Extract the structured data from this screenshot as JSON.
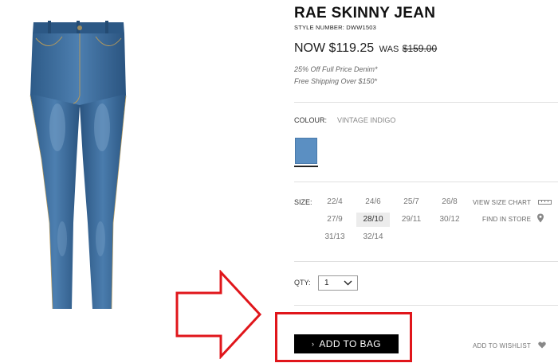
{
  "product": {
    "title": "RAE SKINNY JEAN",
    "style_number": "STYLE NUMBER: DWW1503",
    "price": {
      "now_label": "NOW $119.25",
      "was_label": "WAS",
      "original": "$159.00"
    },
    "promos": [
      "25% Off Full Price Denim*",
      "Free Shipping Over $150*"
    ],
    "image_icon": "jeans-product-photo"
  },
  "colour": {
    "label": "COLOUR:",
    "value": "VINTAGE INDIGO",
    "swatch_color": "#5b8fc2"
  },
  "size": {
    "label": "SIZE:",
    "options": [
      "22/4",
      "24/6",
      "25/7",
      "26/8",
      "27/9",
      "28/10",
      "29/11",
      "30/12",
      "31/13",
      "32/14"
    ],
    "selected": "28/10",
    "view_size_chart": "VIEW SIZE CHART",
    "find_in_store": "FIND IN STORE"
  },
  "qty": {
    "label": "QTY:",
    "value": "1"
  },
  "actions": {
    "add_to_bag": "ADD TO BAG",
    "add_to_wishlist": "ADD TO WISHLIST"
  },
  "annotation": {
    "color": "#e0161b",
    "arrow_icon": "right-arrow-outline",
    "highlight_target": "add-to-bag-button"
  }
}
